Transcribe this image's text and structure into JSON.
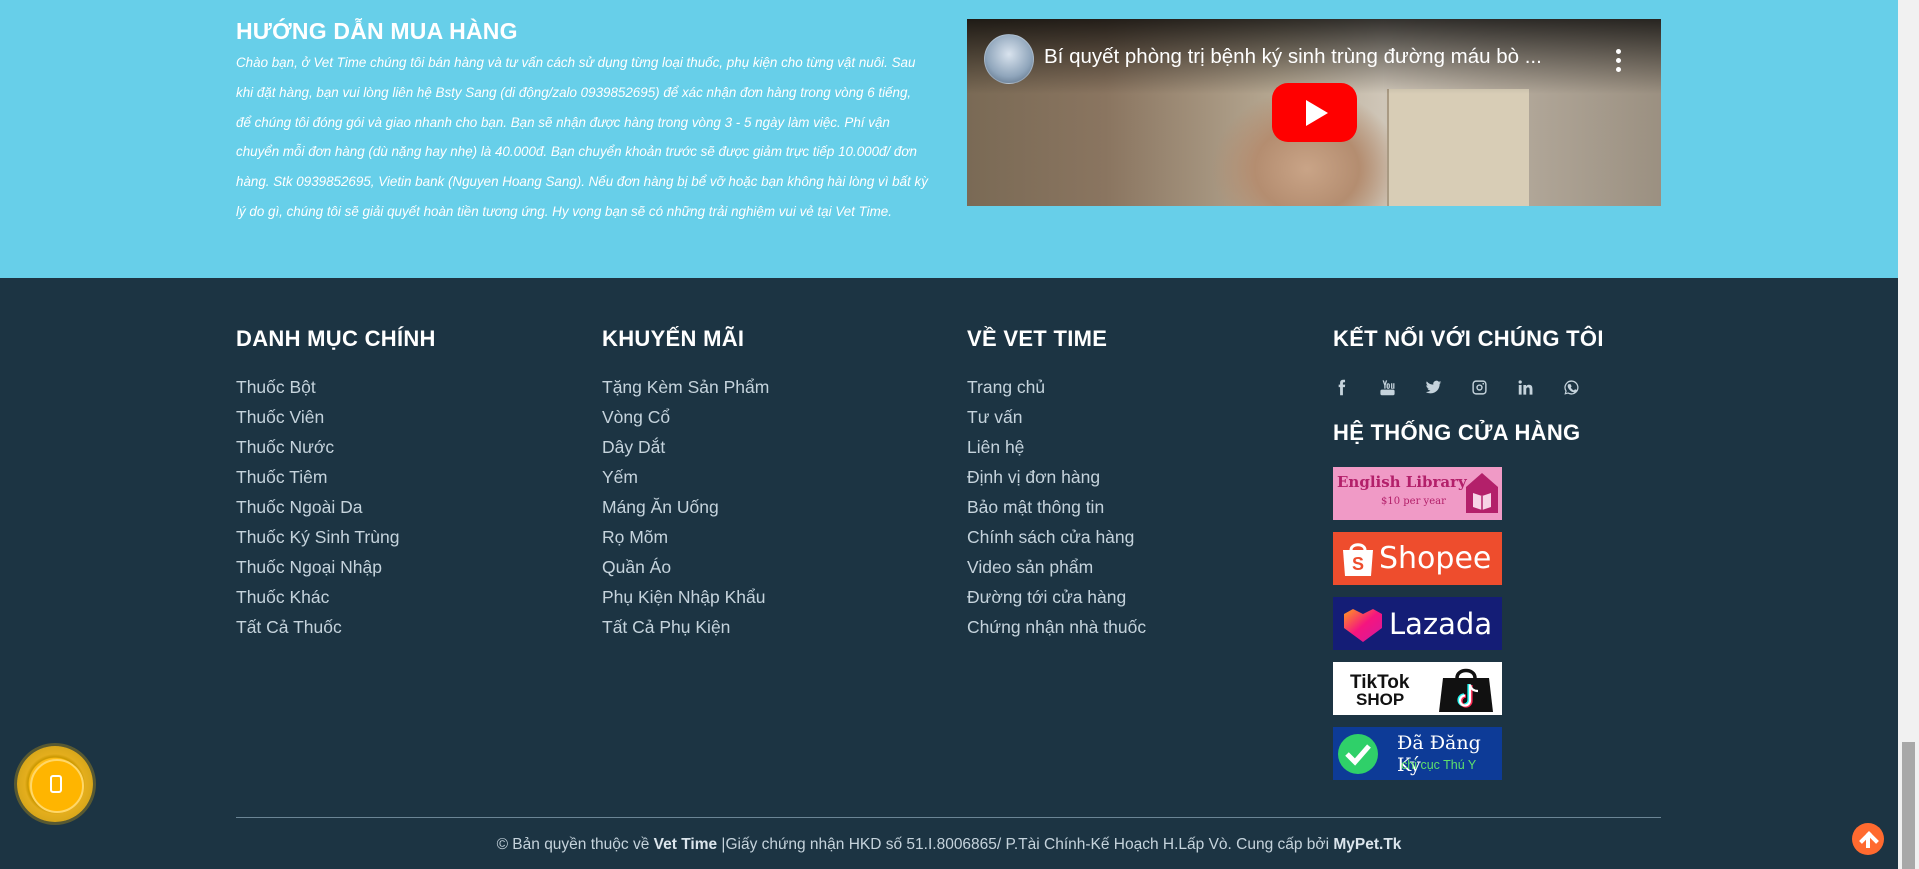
{
  "guide": {
    "title": "HƯỚNG DẪN MUA HÀNG",
    "text": "Chào bạn, ở Vet Time chúng tôi bán hàng và tư vấn cách sử dụng từng loại thuốc, phụ kiện cho từng vật nuôi. Sau khi đặt hàng, bạn vui lòng liên hệ Bsty Sang (di động/zalo 0939852695) để xác nhận đơn hàng trong vòng 6 tiếng, để chúng tôi đóng gói và giao nhanh cho bạn. Bạn sẽ nhận được hàng trong vòng 3 - 5 ngày làm việc. Phí vận chuyển mỗi đơn hàng (dù nặng hay nhẹ) là 40.000đ. Bạn chuyển khoản trước sẽ được giảm trực tiếp 10.000đ/ đơn hàng. Stk 0939852695, Vietin bank (Nguyen Hoang Sang). Nếu đơn hàng bị bể vỡ hoặc bạn không hài lòng vì bất kỳ lý do gì, chúng tôi sẽ giải quyết hoàn tiền tương ứng. Hy vọng bạn sẽ có những trải nghiệm vui vẻ tại Vet Time."
  },
  "video": {
    "title": "Bí quyết phòng trị bệnh ký sinh trùng đường máu bò ...",
    "play_icon": "play-icon",
    "more_icon": "more-vert-icon"
  },
  "footer": {
    "col1": {
      "title": "DANH MỤC CHÍNH",
      "items": [
        "Thuốc Bột",
        "Thuốc Viên",
        "Thuốc Nước",
        "Thuốc Tiêm",
        "Thuốc Ngoài Da",
        "Thuốc Ký Sinh Trùng",
        "Thuốc Ngoại Nhập",
        "Thuốc Khác",
        "Tất Cả Thuốc"
      ]
    },
    "col2": {
      "title": "KHUYẾN MÃI",
      "items": [
        "Tặng Kèm Sản Phẩm",
        "Vòng Cổ",
        "Dây Dắt",
        "Yếm",
        "Máng Ăn Uống",
        "Rọ Mõm",
        "Quần Áo",
        "Phụ Kiện Nhập Khẩu",
        "Tất Cả Phụ Kiện"
      ]
    },
    "col3": {
      "title": "VỀ VET TIME",
      "items": [
        "Trang chủ",
        "Tư vấn",
        "Liên hệ",
        "Định vị đơn hàng",
        "Bảo mật thông tin",
        "Chính sách cửa hàng",
        "Video sản phẩm",
        "Đường tới cửa hàng",
        "Chứng nhận nhà thuốc"
      ]
    },
    "col4": {
      "title": "KẾT NỐI VỚI CHÚNG TÔI",
      "social": [
        "facebook-icon",
        "youtube-icon",
        "twitter-icon",
        "instagram-icon",
        "linkedin-icon",
        "whatsapp-icon"
      ],
      "stores_title": "HỆ THỐNG CỬA HÀNG",
      "stores": {
        "english": {
          "line1": "English Library",
          "line2": "$10 per year"
        },
        "shopee": "Shopee",
        "lazada": "Lazada",
        "tiktok": {
          "line1": "TikTok",
          "line2": "SHOP"
        },
        "registered": {
          "line1": "Đã Đăng Ký",
          "line2": "chi cục Thú Y"
        }
      }
    },
    "copyright": {
      "prefix": "© Bản quyền thuộc về",
      "brand": "Vet Time",
      "middle": "|Giấy chứng nhận HKD số 51.I.8006865/ P.Tài Chính-Kế Hoạch H.Lấp Vò. Cung cấp bởi",
      "provider": "MyPet.Tk"
    }
  },
  "colors": {
    "guide_bg": "#67cfe9",
    "footer_bg": "#1c3443",
    "phone_button": "#ffbe17",
    "scroll_top": "#ff6a2f"
  },
  "floating": {
    "phone_icon": "phone-icon",
    "scroll_top_icon": "arrow-up-icon"
  }
}
